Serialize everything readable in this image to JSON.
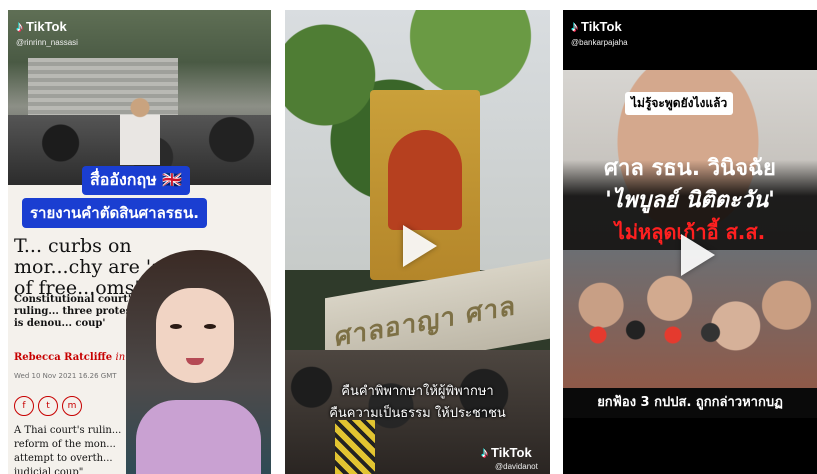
{
  "panels": [
    {
      "logo": "TikTok",
      "handle": "@rinrinn_nassasi",
      "caption_top": "สื่ออังกฤษ 🇬🇧",
      "caption_bottom": "รายงานคำตัดสินศาลรธน.",
      "article": {
        "headline": "T... curbs on mor...chy are 'abuse of free...oms'",
        "subheadline": "Constitutional court's ruling... three protest leaders is denou... coup'",
        "byline_name": "Rebecca Ratcliffe",
        "byline_place": "in Bangkok",
        "date": "Wed 10 Nov 2021 16.26 GMT",
        "share_icons": [
          "f",
          "t",
          "m"
        ],
        "body": "A Thai court's rulin... reform of the mon... attempt to overth... judicial coup\""
      }
    },
    {
      "gate_sign": "ศาลอาญา ศาลยุติธรรม",
      "subtitle_line1": "คืนคำพิพากษาให้ผู้พิพากษา",
      "subtitle_line2": "คืนความเป็นธรรม ให้ประชาชน",
      "logo": "TikTok",
      "handle": "@davidanot"
    },
    {
      "logo": "TikTok",
      "handle": "@bankarpajaha",
      "quote": "ไม่รู้จะพูดยังไงแล้ว",
      "headline1": "ศาล รธน. วินิจฉัย",
      "headline2": "'ไพบูลย์ นิติตะวัน'",
      "headline3": "ไม่หลุดเก้าอี้ ส.ส.",
      "subtitle": "ยกฟ้อง 3 กปปส. ถูกกล่าวหากบฏ"
    }
  ]
}
